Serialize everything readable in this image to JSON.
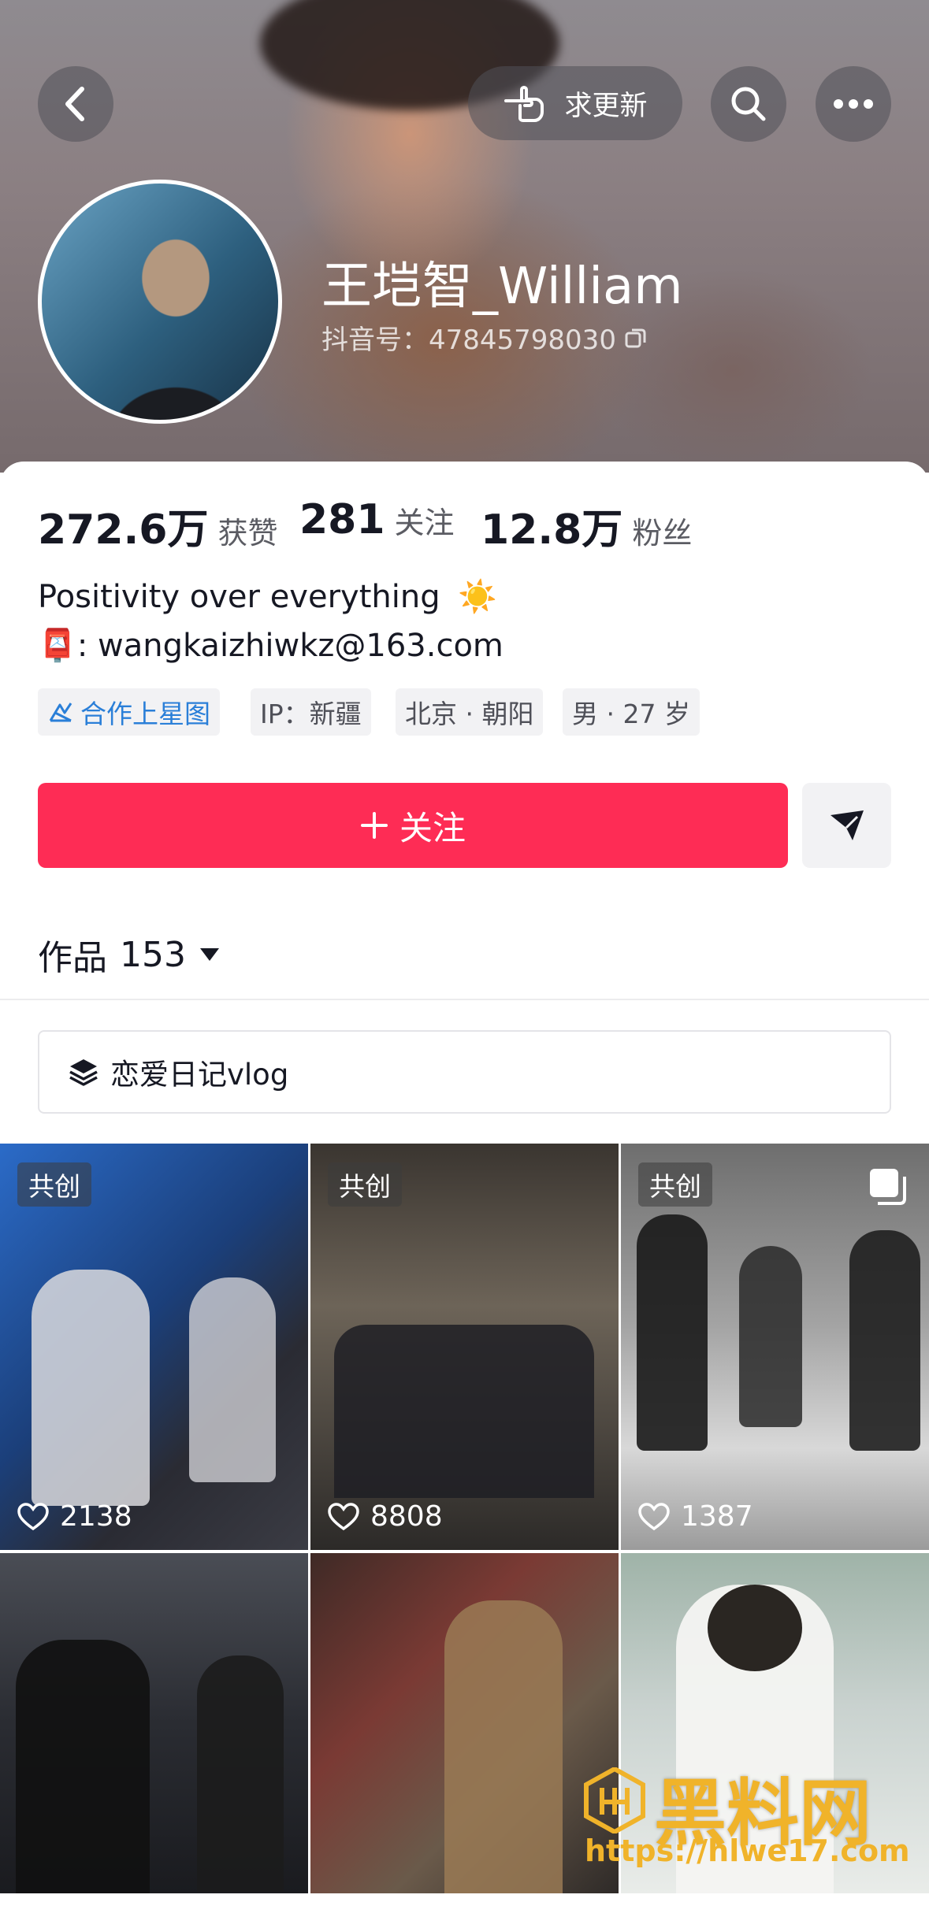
{
  "header": {
    "request_update_label": "求更新",
    "username": "王垲智_William",
    "douyin_id": "抖音号：47845798030"
  },
  "stats": [
    {
      "value": "272.6万",
      "label": "获赞"
    },
    {
      "value": "281",
      "label": "关注"
    },
    {
      "value": "12.8万",
      "label": "粉丝"
    }
  ],
  "bio": {
    "line1": "Positivity over everything",
    "line1_emoji": "☀️",
    "line2_emoji": "📮",
    "line2": ": wangkaizhiwkz@163.com"
  },
  "tags": [
    {
      "label": "合作上星图"
    },
    {
      "label": "IP：新疆"
    },
    {
      "label": "北京 · 朝阳"
    },
    {
      "label": "男 · 27 岁"
    }
  ],
  "actions": {
    "follow_label": "关注"
  },
  "works": {
    "label": "作品",
    "count": "153"
  },
  "collection": {
    "label": "恋爱日记vlog"
  },
  "videos": [
    {
      "badge": "共创",
      "likes": "2138"
    },
    {
      "badge": "共创",
      "likes": "8808"
    },
    {
      "badge": "共创",
      "likes": "1387"
    },
    {
      "badge": "",
      "likes": ""
    },
    {
      "badge": "",
      "likes": ""
    },
    {
      "badge": "",
      "likes": ""
    }
  ],
  "watermark": {
    "text": "黑料网",
    "url": "https://hlwe17.com"
  },
  "colors": {
    "accent": "#fe2c55",
    "link_blue": "#2a7fd8",
    "watermark": "#f0b32a"
  }
}
